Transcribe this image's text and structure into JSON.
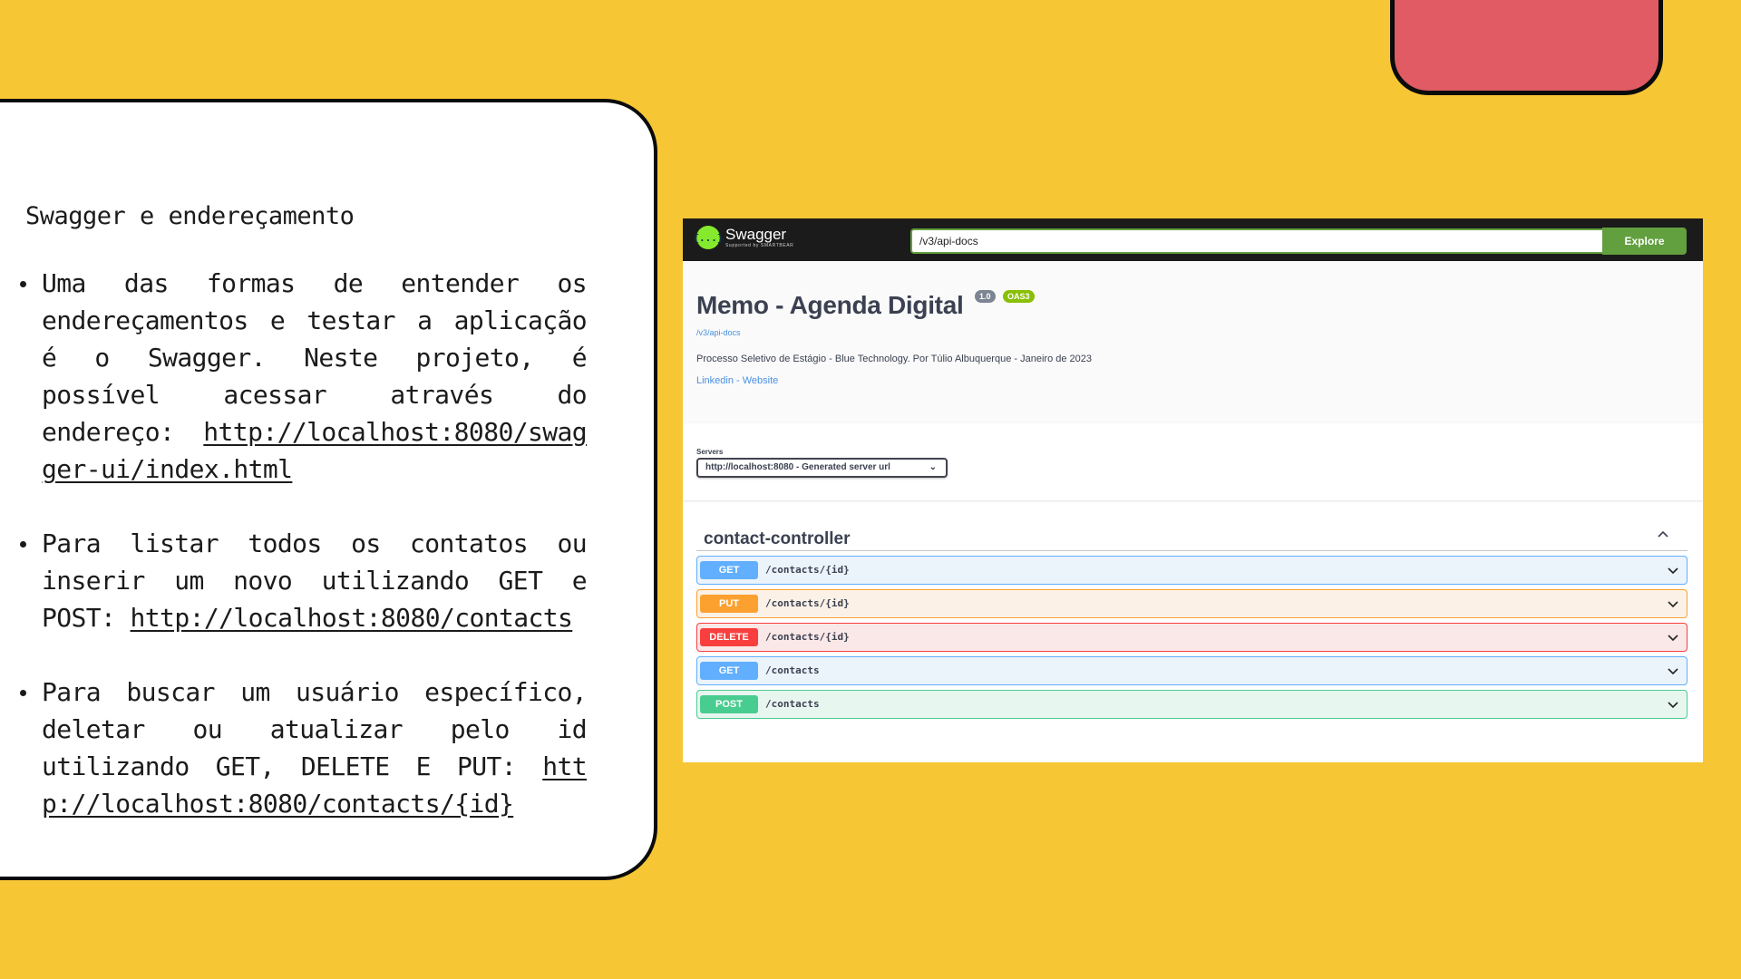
{
  "slide": {
    "title": "Swagger e endereçamento",
    "bullets": [
      {
        "text": "Uma das formas de entender os endereçamentos e testar a aplicação é o Swagger. Neste projeto, é possível acessar através do endereço: ",
        "link": "http://localhost:8080/swagger-ui/index.html"
      },
      {
        "text": "Para listar todos os contatos ou inserir um novo utilizando GET e POST: ",
        "link": "http://localhost:8080/contacts"
      },
      {
        "text": "Para buscar um usuário específico, deletar ou atualizar pelo id utilizando GET, DELETE E PUT: ",
        "link": "http://localhost:8080/contacts/{id}"
      }
    ]
  },
  "swagger": {
    "logo_name": "Swagger",
    "logo_sub": "Supported by SMARTBEAR",
    "logo_mark": "{...}",
    "url_value": "/v3/api-docs",
    "explore_label": "Explore",
    "info": {
      "title": "Memo - Agenda Digital",
      "version": "1.0",
      "oas": "OAS3",
      "url": "/v3/api-docs",
      "description": "Processo Seletivo de Estágio - Blue Technology. Por Túlio Albuquerque - Janeiro de 2023",
      "links": "Linkedin - Website"
    },
    "servers": {
      "label": "Servers",
      "selected": "http://localhost:8080 - Generated server url"
    },
    "tag": {
      "name": "contact-controller",
      "operations": [
        {
          "method": "GET",
          "path": "/contacts/{id}"
        },
        {
          "method": "PUT",
          "path": "/contacts/{id}"
        },
        {
          "method": "DELETE",
          "path": "/contacts/{id}"
        },
        {
          "method": "GET",
          "path": "/contacts"
        },
        {
          "method": "POST",
          "path": "/contacts"
        }
      ]
    }
  },
  "colors": {
    "background": "#f7c634",
    "accent_red": "#e05b63",
    "get": "#61affe",
    "put": "#fca130",
    "delete": "#f93e3e",
    "post": "#49cc90",
    "swagger_green": "#62a03f"
  }
}
